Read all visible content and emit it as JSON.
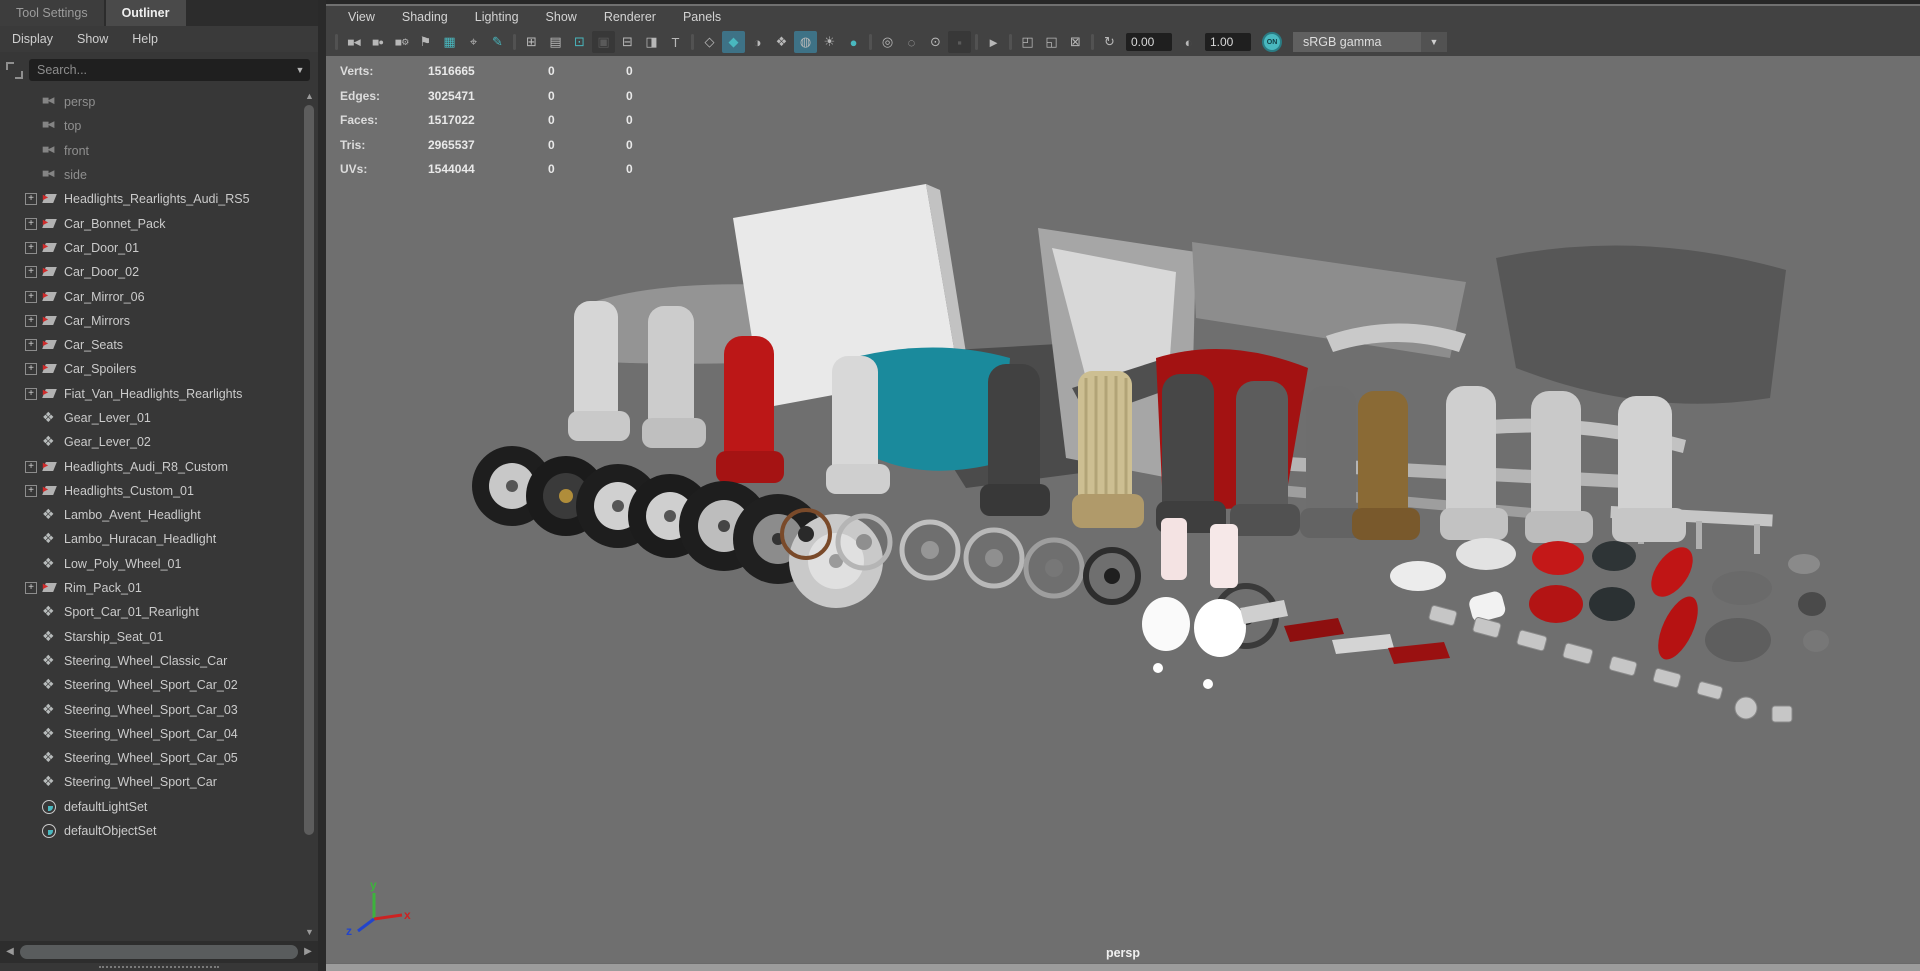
{
  "colors": {
    "accent": "#49b8bf",
    "viewport_bg": "#6f6f6f",
    "red_part": "#bc1717",
    "teal_part": "#1a8a9c"
  },
  "left_panel": {
    "tabs": [
      {
        "label": "Tool Settings",
        "name": "tab-tool-settings",
        "active": false
      },
      {
        "label": "Outliner",
        "name": "tab-outliner",
        "active": true
      }
    ],
    "menus": [
      {
        "label": "Display",
        "name": "menu-display"
      },
      {
        "label": "Show",
        "name": "menu-show"
      },
      {
        "label": "Help",
        "name": "menu-help"
      }
    ],
    "search_placeholder": "Search...",
    "items": [
      {
        "label": "persp",
        "type": "camera",
        "muted": true
      },
      {
        "label": "top",
        "type": "camera",
        "muted": true
      },
      {
        "label": "front",
        "type": "camera",
        "muted": true
      },
      {
        "label": "side",
        "type": "camera",
        "muted": true
      },
      {
        "label": "Headlights_Rearlights_Audi_RS5",
        "type": "transform",
        "expandable": true
      },
      {
        "label": "Car_Bonnet_Pack",
        "type": "transform",
        "expandable": true
      },
      {
        "label": "Car_Door_01",
        "type": "transform",
        "expandable": true
      },
      {
        "label": "Car_Door_02",
        "type": "transform",
        "expandable": true
      },
      {
        "label": "Car_Mirror_06",
        "type": "transform",
        "expandable": true
      },
      {
        "label": "Car_Mirrors",
        "type": "transform",
        "expandable": true
      },
      {
        "label": "Car_Seats",
        "type": "transform",
        "expandable": true
      },
      {
        "label": "Car_Spoilers",
        "type": "transform",
        "expandable": true
      },
      {
        "label": "Fiat_Van_Headlights_Rearlights",
        "type": "transform",
        "expandable": true
      },
      {
        "label": "Gear_Lever_01",
        "type": "mesh"
      },
      {
        "label": "Gear_Lever_02",
        "type": "mesh"
      },
      {
        "label": "Headlights_Audi_R8_Custom",
        "type": "transform",
        "expandable": true
      },
      {
        "label": "Headlights_Custom_01",
        "type": "transform",
        "expandable": true
      },
      {
        "label": "Lambo_Avent_Headlight",
        "type": "mesh"
      },
      {
        "label": "Lambo_Huracan_Headlight",
        "type": "mesh"
      },
      {
        "label": "Low_Poly_Wheel_01",
        "type": "mesh"
      },
      {
        "label": "Rim_Pack_01",
        "type": "transform",
        "expandable": true
      },
      {
        "label": "Sport_Car_01_Rearlight",
        "type": "mesh"
      },
      {
        "label": "Starship_Seat_01",
        "type": "mesh"
      },
      {
        "label": "Steering_Wheel_Classic_Car",
        "type": "mesh"
      },
      {
        "label": "Steering_Wheel_Sport_Car_02",
        "type": "mesh"
      },
      {
        "label": "Steering_Wheel_Sport_Car_03",
        "type": "mesh"
      },
      {
        "label": "Steering_Wheel_Sport_Car_04",
        "type": "mesh"
      },
      {
        "label": "Steering_Wheel_Sport_Car_05",
        "type": "mesh"
      },
      {
        "label": "Steering_Wheel_Sport_Car",
        "type": "mesh"
      },
      {
        "label": "defaultLightSet",
        "type": "set"
      },
      {
        "label": "defaultObjectSet",
        "type": "set"
      }
    ]
  },
  "viewport": {
    "menus": [
      {
        "label": "View",
        "name": "vp-menu-view"
      },
      {
        "label": "Shading",
        "name": "vp-menu-shading"
      },
      {
        "label": "Lighting",
        "name": "vp-menu-lighting"
      },
      {
        "label": "Show",
        "name": "vp-menu-show"
      },
      {
        "label": "Renderer",
        "name": "vp-menu-renderer"
      },
      {
        "label": "Panels",
        "name": "vp-menu-panels"
      }
    ],
    "toolbar": {
      "icons": [
        {
          "name": "toolbar-separator",
          "glyph": "",
          "style": "sep"
        },
        {
          "name": "select-camera-icon",
          "glyph": "◼◀",
          "style": "small"
        },
        {
          "name": "lock-camera-icon",
          "glyph": "◼●",
          "style": "small"
        },
        {
          "name": "camera-attributes-icon",
          "glyph": "◼⚙",
          "style": "small"
        },
        {
          "name": "bookmark-icon",
          "glyph": "⚑"
        },
        {
          "name": "image-plane-icon",
          "glyph": "▦",
          "style": "accent"
        },
        {
          "name": "pan-zoom-icon",
          "glyph": "⌖"
        },
        {
          "name": "grease-pencil-icon",
          "glyph": "✎",
          "style": "accent"
        },
        {
          "name": "toolbar-separator",
          "glyph": "",
          "style": "sep"
        },
        {
          "name": "grid-icon",
          "glyph": "⊞"
        },
        {
          "name": "film-gate-icon",
          "glyph": "▤"
        },
        {
          "name": "resolution-gate-icon",
          "glyph": "⊡",
          "style": "accent"
        },
        {
          "name": "gate-mask-icon",
          "glyph": "▣",
          "style": "dark"
        },
        {
          "name": "field-chart-icon",
          "glyph": "⊟"
        },
        {
          "name": "safe-action-icon",
          "glyph": "◨"
        },
        {
          "name": "safe-title-icon",
          "glyph": "T"
        },
        {
          "name": "toolbar-separator",
          "glyph": "",
          "style": "sep"
        },
        {
          "name": "wireframe-mode-icon",
          "glyph": "◇"
        },
        {
          "name": "shaded-mode-icon",
          "glyph": "◆",
          "style": "accent active"
        },
        {
          "name": "material-preview-icon",
          "glyph": "◑"
        },
        {
          "name": "textured-mode-icon",
          "glyph": "❖"
        },
        {
          "name": "wireframe-on-shaded-icon",
          "glyph": "◍",
          "style": "active"
        },
        {
          "name": "use-all-lights-icon",
          "glyph": "☀"
        },
        {
          "name": "shadows-icon",
          "glyph": "●",
          "style": "accent"
        },
        {
          "name": "toolbar-separator",
          "glyph": "",
          "style": "sep"
        },
        {
          "name": "ambient-occlusion-icon",
          "glyph": "◎"
        },
        {
          "name": "motion-blur-icon",
          "glyph": "◌"
        },
        {
          "name": "multisample-aa-icon",
          "glyph": "⊙"
        },
        {
          "name": "camera-capture-icon",
          "glyph": "▪",
          "style": "dark"
        },
        {
          "name": "toolbar-separator",
          "glyph": "",
          "style": "sep"
        },
        {
          "name": "isolate-select-icon",
          "glyph": "►"
        },
        {
          "name": "toolbar-separator",
          "glyph": "",
          "style": "sep"
        },
        {
          "name": "xray-icon",
          "glyph": "◰"
        },
        {
          "name": "xray-active-icon",
          "glyph": "◱"
        },
        {
          "name": "xray-joints-icon",
          "glyph": "⊠"
        },
        {
          "name": "toolbar-separator",
          "glyph": "",
          "style": "sep"
        },
        {
          "name": "exposure-icon",
          "glyph": "↻"
        }
      ],
      "exposure_value": "0.00",
      "contrast_icon": "◐",
      "contrast_value": "1.00",
      "on_label": "ON",
      "gamma_selected": "sRGB gamma"
    },
    "hud": {
      "rows": [
        {
          "label": "Verts:",
          "scene": "1516665",
          "col2": "0",
          "col3": "0"
        },
        {
          "label": "Edges:",
          "scene": "3025471",
          "col2": "0",
          "col3": "0"
        },
        {
          "label": "Faces:",
          "scene": "1517022",
          "col2": "0",
          "col3": "0"
        },
        {
          "label": "Tris:",
          "scene": "2965537",
          "col2": "0",
          "col3": "0"
        },
        {
          "label": "UVs:",
          "scene": "1544044",
          "col2": "0",
          "col3": "0"
        }
      ]
    },
    "camera_label": "persp",
    "axis": {
      "x": "x",
      "y": "y",
      "z": "z"
    }
  },
  "scrollbar": {
    "up": "▲",
    "down": "▼",
    "left": "◀",
    "right": "▶",
    "caret": "▼"
  }
}
